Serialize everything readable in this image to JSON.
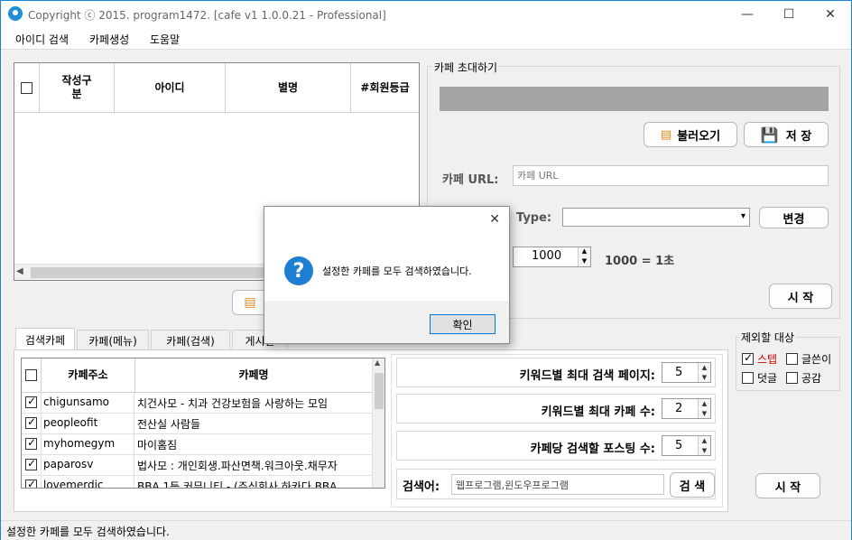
{
  "window": {
    "title": "Copyright ⓒ 2015. program1472. [cafe v1 1.0.0.21 - Professional]",
    "minimize": "—",
    "maximize": "☐",
    "close": "✕"
  },
  "menu": [
    "아이디 검색",
    "카페생성",
    "도움말"
  ],
  "member_grid": {
    "headers": [
      "작성구\n분",
      "아이디",
      "별명",
      "#회원등급"
    ]
  },
  "invite": {
    "group_title": "카페 초대하기",
    "load_button": "불러오기",
    "save_button": "저  장",
    "url_label": "카페 URL:",
    "url_placeholder": "카페 URL",
    "type_label": "Type:",
    "change_button": "변경",
    "interval_value": "1000",
    "interval_note": "1000 = 1초",
    "start_button": "시  작"
  },
  "tabs": [
    "검색카페",
    "카페(메뉴)",
    "카페(검색)",
    "게시판"
  ],
  "cafe_grid": {
    "headers": [
      "카페주소",
      "카페명"
    ],
    "rows": [
      {
        "checked": true,
        "address": "chigunsamo",
        "name": "치건사모 - 치과 건강보험을 사랑하는 모임"
      },
      {
        "checked": true,
        "address": "peopleofit",
        "name": "전산실 사람들"
      },
      {
        "checked": true,
        "address": "myhomegym",
        "name": "마이홈짐"
      },
      {
        "checked": true,
        "address": "paparosv",
        "name": "법사모 : 개인회생.파산면책.워크아웃.채무자"
      },
      {
        "checked": true,
        "address": "lovemerdic",
        "name": "BBA 1등 커뮤니티 - (주식회사 하카다 BBA"
      }
    ]
  },
  "search_options": {
    "max_pages_label": "키워드별 최대 검색 페이지:",
    "max_pages_value": "5",
    "max_cafes_label": "키워드별 최대 카페 수:",
    "max_cafes_value": "2",
    "posts_label": "카페당 검색할 포스팅 수:",
    "posts_value": "5",
    "keyword_label": "검색어:",
    "keyword_value": "웹프로그램,윈도우프로그램",
    "search_button": "검 색"
  },
  "exclude": {
    "title": "제외할 대상",
    "items": [
      {
        "label": "스텝",
        "checked": true,
        "color": "#d40000"
      },
      {
        "label": "글쓴이",
        "checked": false
      },
      {
        "label": "덧글",
        "checked": false
      },
      {
        "label": "공감",
        "checked": false
      }
    ],
    "start_button": "시  작"
  },
  "dialog": {
    "message": "설정한 카페를 모두 검색하였습니다.",
    "ok_button": "확인",
    "close": "✕",
    "icon": "?"
  },
  "status": "설정한 카페를 모두 검색하였습니다."
}
